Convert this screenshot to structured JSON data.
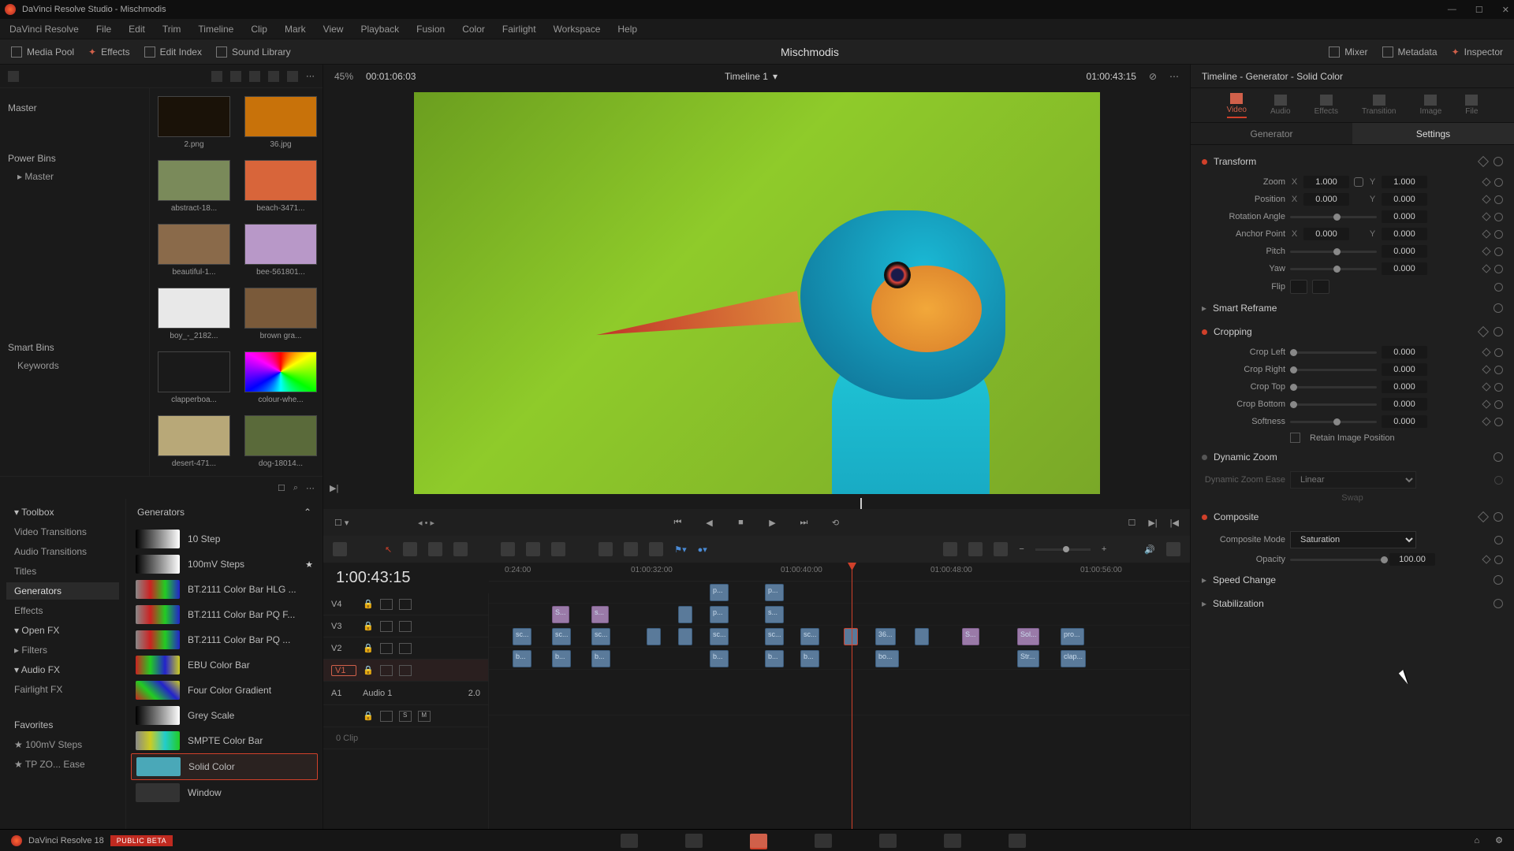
{
  "titlebar": {
    "text": "DaVinci Resolve Studio - Mischmodis"
  },
  "menu": [
    "DaVinci Resolve",
    "File",
    "Edit",
    "Trim",
    "Timeline",
    "Clip",
    "Mark",
    "View",
    "Playback",
    "Fusion",
    "Color",
    "Fairlight",
    "Workspace",
    "Help"
  ],
  "toolbar": {
    "media_pool": "Media Pool",
    "effects": "Effects",
    "edit_index": "Edit Index",
    "sound_library": "Sound Library",
    "project": "Mischmodis",
    "mixer": "Mixer",
    "metadata": "Metadata",
    "inspector": "Inspector"
  },
  "bins": {
    "master": "Master",
    "power": "Power Bins",
    "power_item": "Master",
    "smart": "Smart Bins",
    "smart_item": "Keywords",
    "thumbs": [
      {
        "n": "2.png"
      },
      {
        "n": "36.jpg"
      },
      {
        "n": "abstract-18..."
      },
      {
        "n": "beach-3471..."
      },
      {
        "n": "beautiful-1..."
      },
      {
        "n": "bee-561801..."
      },
      {
        "n": "boy_-_2182..."
      },
      {
        "n": "brown gra..."
      },
      {
        "n": "clapperboa..."
      },
      {
        "n": "colour-whe..."
      },
      {
        "n": "desert-471..."
      },
      {
        "n": "dog-18014..."
      }
    ]
  },
  "viewer": {
    "zoom": "45%",
    "left_tc": "00:01:06:03",
    "timeline_name": "Timeline 1",
    "right_tc": "01:00:43:15"
  },
  "fxtree": {
    "title": "Generators",
    "items": [
      "Toolbox",
      "Video Transitions",
      "Audio Transitions",
      "Titles",
      "Generators",
      "Effects",
      "Open FX",
      "Filters",
      "Audio FX",
      "Fairlight FX"
    ],
    "favorites_h": "Favorites",
    "favorites": [
      "100mV Steps",
      "TP ZO... Ease"
    ],
    "list": [
      {
        "n": "10 Step"
      },
      {
        "n": "100mV Steps"
      },
      {
        "n": "BT.2111 Color Bar HLG ..."
      },
      {
        "n": "BT.2111 Color Bar PQ F..."
      },
      {
        "n": "BT.2111 Color Bar PQ ..."
      },
      {
        "n": "EBU Color Bar"
      },
      {
        "n": "Four Color Gradient"
      },
      {
        "n": "Grey Scale"
      },
      {
        "n": "SMPTE Color Bar"
      },
      {
        "n": "Solid Color"
      },
      {
        "n": "Window"
      }
    ]
  },
  "timeline": {
    "tc": "1:00:43:15",
    "ruler": [
      "0:24:00",
      "01:00:32:00",
      "01:00:40:00",
      "01:00:48:00",
      "01:00:56:00"
    ],
    "tracks_v": [
      "V4",
      "V3",
      "V2",
      "V1"
    ],
    "audio_name": "Audio 1",
    "audio_track": "A1",
    "audio_fmt": "2.0",
    "clip_count": "0 Clip"
  },
  "inspector": {
    "title": "Timeline - Generator - Solid Color",
    "tabs": [
      "Video",
      "Audio",
      "Effects",
      "Transition",
      "Image",
      "File"
    ],
    "subtabs": [
      "Generator",
      "Settings"
    ],
    "transform": {
      "h": "Transform",
      "zoom_l": "Zoom",
      "zoom_x": "1.000",
      "zoom_y": "1.000",
      "pos_l": "Position",
      "pos_x": "0.000",
      "pos_y": "0.000",
      "rot_l": "Rotation Angle",
      "rot": "0.000",
      "anc_l": "Anchor Point",
      "anc_x": "0.000",
      "anc_y": "0.000",
      "pitch_l": "Pitch",
      "pitch": "0.000",
      "yaw_l": "Yaw",
      "yaw": "0.000",
      "flip_l": "Flip"
    },
    "reframe": "Smart Reframe",
    "cropping": {
      "h": "Cropping",
      "left_l": "Crop Left",
      "left": "0.000",
      "right_l": "Crop Right",
      "right": "0.000",
      "top_l": "Crop Top",
      "top": "0.000",
      "bottom_l": "Crop Bottom",
      "bottom": "0.000",
      "soft_l": "Softness",
      "soft": "0.000",
      "retain": "Retain Image Position"
    },
    "dynzoom": {
      "h": "Dynamic Zoom",
      "ease_l": "Dynamic Zoom Ease",
      "ease": "Linear",
      "swap": "Swap"
    },
    "composite": {
      "h": "Composite",
      "mode_l": "Composite Mode",
      "mode": "Saturation",
      "op_l": "Opacity",
      "op": "100.00"
    },
    "speed": "Speed Change",
    "stab": "Stabilization"
  },
  "bottom": {
    "app": "DaVinci Resolve 18",
    "beta": "PUBLIC BETA"
  }
}
